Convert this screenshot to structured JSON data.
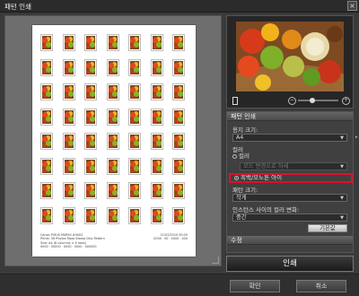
{
  "window": {
    "title": "패턴 인쇄",
    "close_glyph": "×"
  },
  "preview": {
    "grid_cols": 7,
    "grid_rows": 8,
    "footer_left": [
      "Canon PIXUS MX850 #0002",
      "Prints: 56 Photos Mass Stamp Disc Pattern",
      "Size: A4 (8 columns × 8 rows)",
      "0000 · 00000 · 0000 · 0000 · 000000"
    ],
    "footer_right": [
      "21/02/2010 00:00",
      "0000 · 00 · 0000 · 000"
    ]
  },
  "thumb": {
    "zoom_level": 0.35
  },
  "settings": {
    "section_title": "패턴 인쇄",
    "paper_size_label": "용지 크기:",
    "paper_size_value": "A4",
    "color_label": "컬러",
    "radio_color": "컬러",
    "disabled_dropdown": "모드 변경으로 하세",
    "radio_mono": "흑백/모노톤 아이",
    "pattern_size_label": "패턴 크기:",
    "pattern_size_value": "작게",
    "instance_color_label": "인스턴스 사이의 컬러 변화:",
    "instance_color_value": "중간",
    "default_button": "기본값",
    "edit_section": "수정"
  },
  "actions": {
    "print": "인쇄",
    "confirm": "확인",
    "cancel": "취소"
  }
}
